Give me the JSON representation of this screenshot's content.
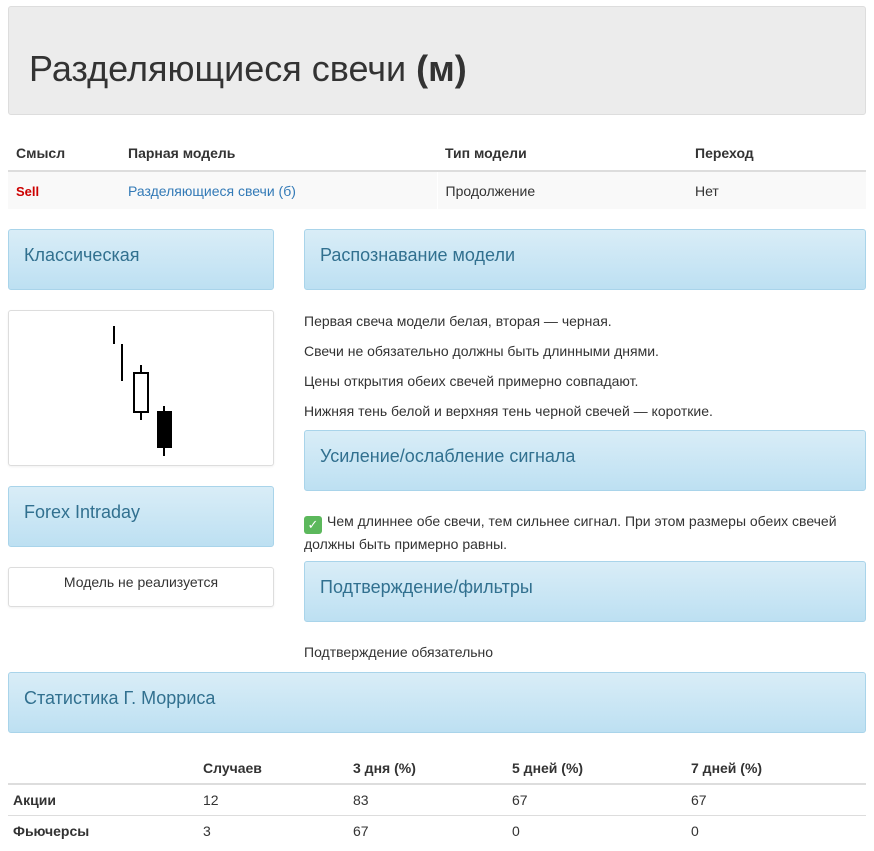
{
  "header": {
    "title": "Разделяющиеся свечи ",
    "title_suffix": "(м)"
  },
  "info_table": {
    "headers": [
      "Смысл",
      "Парная модель",
      "Тип модели",
      "Переход"
    ],
    "row": {
      "meaning": "Sell",
      "pair_model": "Разделяющиеся свечи (б)",
      "model_type": "Продолжение",
      "transition": "Нет"
    }
  },
  "classic": {
    "title": "Классическая"
  },
  "forex": {
    "title": "Forex Intraday",
    "text": "Модель не реализуется"
  },
  "recognition": {
    "title": "Распознавание модели",
    "lines": [
      "Первая свеча модели белая, вторая — черная.",
      "Свечи не обязательно должны быть длинными днями.",
      "Цены открытия обеих свечей примерно совпадают.",
      "Нижняя тень белой и верхняя тень черной свечей — короткие."
    ]
  },
  "signal": {
    "title": "Усиление/ослабление сигнала",
    "text": "Чем длиннее обе свечи, тем сильнее сигнал. При этом размеры обеих свечей должны быть примерно равны.",
    "icon": "checkmark-icon"
  },
  "confirmation": {
    "title": "Подтверждение/фильтры",
    "text": "Подтверждение обязательно"
  },
  "stats": {
    "title": "Статистика Г. Морриса",
    "headers": [
      "",
      "Случаев",
      "3 дня (%)",
      "5 дней (%)",
      "7 дней (%)"
    ],
    "rows": [
      [
        "Акции",
        "12",
        "83",
        "67",
        "67"
      ],
      [
        "Фьючерсы",
        "3",
        "67",
        "0",
        "0"
      ]
    ]
  },
  "colors": {
    "sell": "#cc0000",
    "link": "#337ab7",
    "panel_text": "#31708f",
    "check": "#5cb85c"
  }
}
